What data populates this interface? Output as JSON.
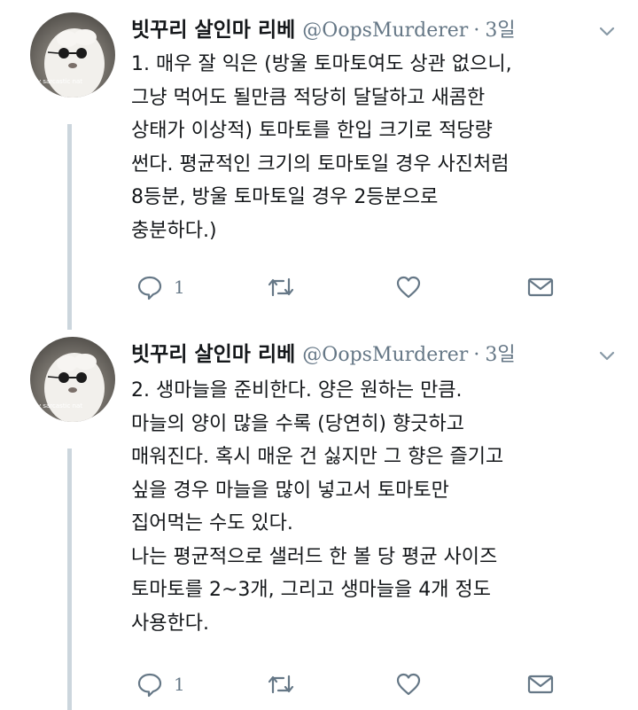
{
  "tweets": [
    {
      "display_name": "빗꾸리 살인마 리베",
      "handle": "@OopsMurderer",
      "separator": "·",
      "time": "3일",
      "avatar_caption": "y sarcastic nat",
      "text": "1. 매우 잘 익은 (방울 토마토여도 상관 없으니,\n그냥 먹어도 될만큼 적당히 달달하고 새콤한\n상태가 이상적) 토마토를 한입 크기로 적당량\n썬다. 평균적인 크기의 토마토일 경우 사진처럼\n8등분, 방울 토마토일 경우 2등분으로\n충분하다.)",
      "reply_count": "1",
      "icons": {
        "reply": "reply-icon",
        "retweet": "retweet-icon",
        "like": "heart-icon",
        "dm": "envelope-icon",
        "menu": "chevron-down-icon"
      }
    },
    {
      "display_name": "빗꾸리 살인마 리베",
      "handle": "@OopsMurderer",
      "separator": "·",
      "time": "3일",
      "avatar_caption": "y sarcastic nat",
      "text": "2. 생마늘을 준비한다. 양은 원하는 만큼.\n마늘의 양이 많을 수록 (당연히) 향긋하고\n매워진다. 혹시 매운 건 싫지만 그 향은 즐기고\n싶을 경우 마늘을 많이 넣고서 토마토만\n집어먹는 수도 있다.\n나는 평균적으로 샐러드 한 볼 당 평균 사이즈\n토마토를 2~3개, 그리고 생마늘을 4개 정도\n사용한다.",
      "reply_count": "1",
      "icons": {
        "reply": "reply-icon",
        "retweet": "retweet-icon",
        "like": "heart-icon",
        "dm": "envelope-icon",
        "menu": "chevron-down-icon"
      }
    }
  ],
  "colors": {
    "text": "#14171a",
    "muted": "#657786",
    "thread_line": "#ccd6dd"
  }
}
